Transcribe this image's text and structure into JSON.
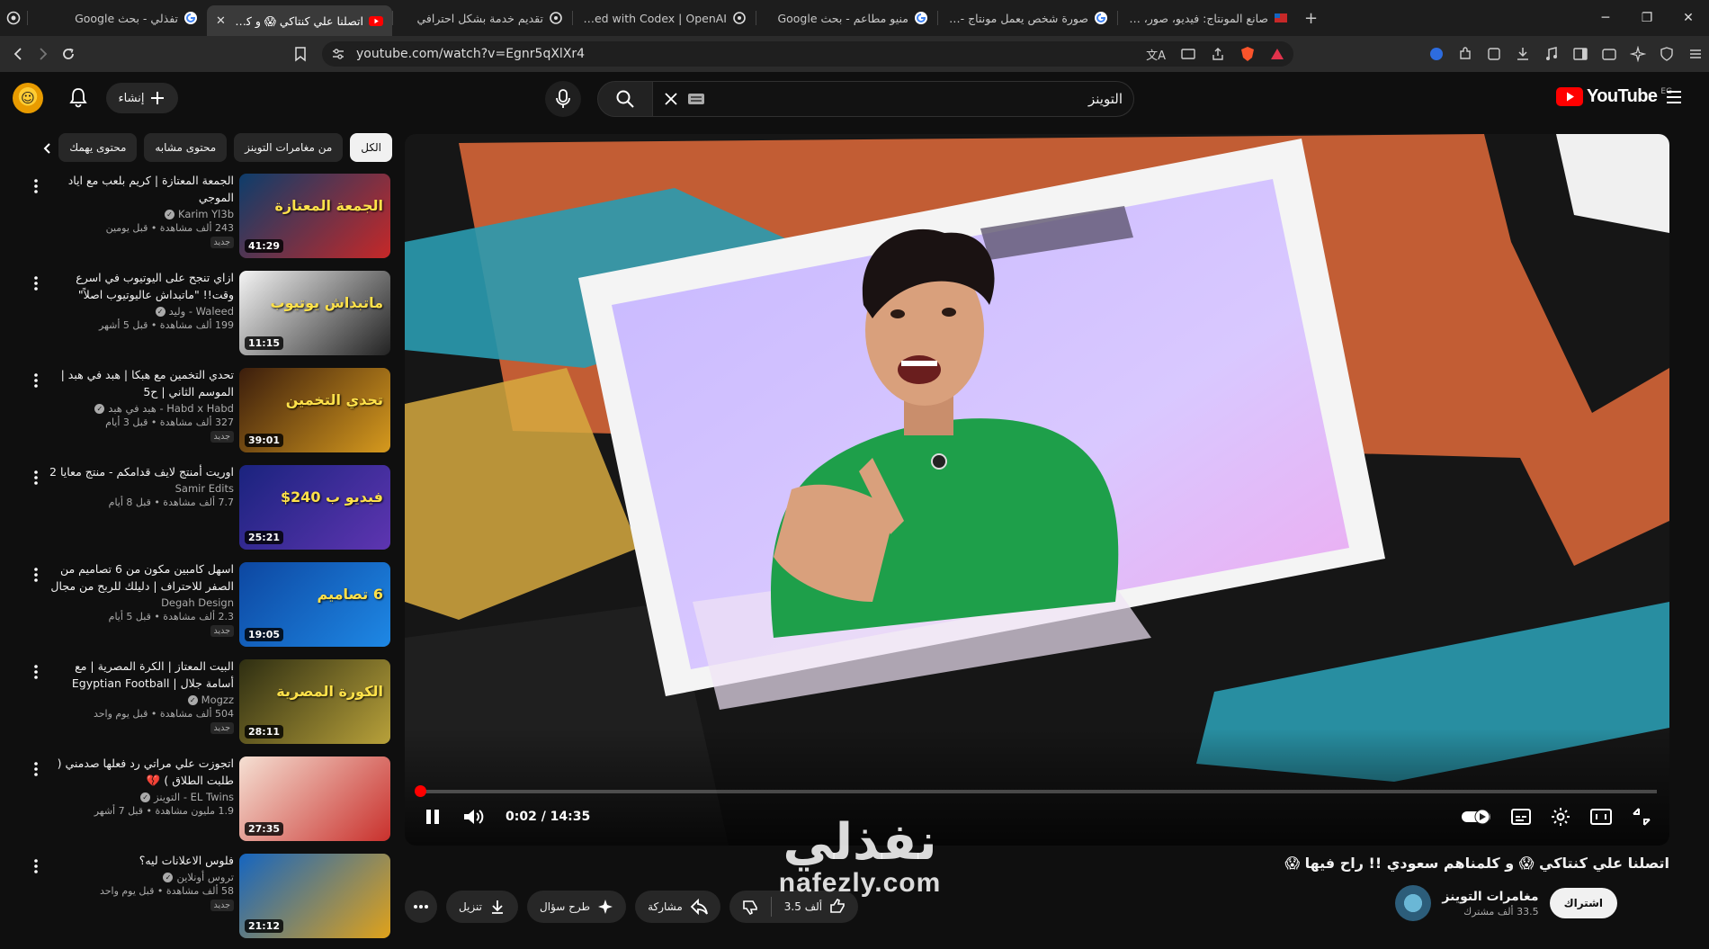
{
  "browser": {
    "tabs": [
      {
        "title": "تفذلي - بحث Google",
        "icon": "google-favicon",
        "active": false
      },
      {
        "title": "اتصلنا علي كنتاكي 😱 و كلمناهم سعودي",
        "icon": "youtube-favicon",
        "active": true
      },
      {
        "title": "تقديم خدمة بشكل احترافي",
        "icon": "openai-favicon",
        "active": false
      },
      {
        "title": "Get started with Codex | OpenAI",
        "icon": "openai-favicon",
        "active": false
      },
      {
        "title": "منيو مطاعم - بحث Google",
        "icon": "google-favicon",
        "active": false
      },
      {
        "title": "صورة شخص يعمل مونتاج - بحث Google",
        "icon": "google-favicon",
        "active": false
      },
      {
        "title": "صانع المونتاج: فيديو، صور، وموسيقى",
        "icon": "app-favicon",
        "active": false
      }
    ],
    "new_tab": "+",
    "url": "youtube.com/watch?v=Egnr5qXlXr4",
    "win_minimize": "─",
    "win_maximize": "❐",
    "win_close": "✕"
  },
  "header": {
    "logo_text": "YouTube",
    "region": "EG",
    "search_value": "التوينز",
    "create_label": "إنشاء"
  },
  "chips": [
    {
      "label": "الكل",
      "active": true
    },
    {
      "label": "من مغامرات التوينز",
      "active": false
    },
    {
      "label": "محتوى مشابه",
      "active": false
    },
    {
      "label": "محتوى يهمك",
      "active": false
    }
  ],
  "related": [
    {
      "title": "الجمعة المعتازة | كريم بلعب مع اياد الموجي",
      "channel": "Karim Yl3b",
      "verified": true,
      "stats": "243 ألف مشاهدة • قبل يومين",
      "badge": "جديد",
      "duration": "41:29",
      "thumb_text": "الجمعة المعتازة",
      "c1": "#0d3d6b",
      "c2": "#c62828"
    },
    {
      "title": "ازاي تنجح على اليوتيوب في اسرع وقت!! \"ماتبداش عاليوتيوب اصلاً\"",
      "channel": "Waleed - وليد",
      "verified": true,
      "stats": "199 ألف مشاهدة • قبل 5 أشهر",
      "badge": "",
      "duration": "11:15",
      "thumb_text": "ماتبداش يوتيوب",
      "c1": "#f4f4f4",
      "c2": "#222222"
    },
    {
      "title": "تحدي التخمين مع هبكا | هبد في هبد | الموسم الثاني | ح5",
      "channel": "Habd x Habd - هبد في هبد",
      "verified": true,
      "stats": "327 ألف مشاهدة • قبل 3 أيام",
      "badge": "جديد",
      "duration": "39:01",
      "thumb_text": "تحدي التخمين",
      "c1": "#3b1d0c",
      "c2": "#d69a1e"
    },
    {
      "title": "اوريت أمنتج لايف قدامكم - منتج معايا 2",
      "channel": "Samir Edits",
      "verified": false,
      "stats": "7.7 ألف مشاهدة • قبل 8 أيام",
      "badge": "",
      "duration": "25:21",
      "thumb_text": "فيديو ب 240$",
      "c1": "#1a237e",
      "c2": "#5e35b1"
    },
    {
      "title": "اسهل كامبين مكون من 6 تصاميم من الصفر للاحتراف | دليلك للربح من مجال الجرافيك ...",
      "channel": "Degah Design",
      "verified": false,
      "stats": "2.3 ألف مشاهدة • قبل 5 أيام",
      "badge": "جديد",
      "duration": "19:05",
      "thumb_text": "6 تصاميم",
      "c1": "#0d47a1",
      "c2": "#1e88e5"
    },
    {
      "title": "البيت المعتاز | الكرة المصرية | مع أسامة جلال | Egyptian Football",
      "channel": "Mogzz",
      "verified": true,
      "stats": "504 ألف مشاهدة • قبل يوم واحد",
      "badge": "جديد",
      "duration": "28:11",
      "thumb_text": "الكورة المصرية",
      "c1": "#2e2e12",
      "c2": "#b8a13a"
    },
    {
      "title": "اتجوزت علي مراتي رد فعلها صدمني ( طلبت الطلاق ) 💔",
      "channel": "EL Twins - التوينز",
      "verified": true,
      "stats": "1.9 مليون مشاهدة • قبل 7 أشهر",
      "badge": "",
      "duration": "27:35",
      "thumb_text": "",
      "c1": "#f5e0d3",
      "c2": "#c9302c"
    },
    {
      "title": "فلوس الاعلانات ليه؟",
      "channel": "تروس أونلاين",
      "verified": true,
      "stats": "58 ألف مشاهدة • قبل يوم واحد",
      "badge": "جديد",
      "duration": "21:12",
      "thumb_text": "",
      "c1": "#1565c0",
      "c2": "#e0a21a"
    }
  ],
  "player": {
    "time": "0:02 / 14:35",
    "progress": 0.0023
  },
  "video": {
    "title": "اتصلنا علي كنتاكي 😱 و كلمناهم سعودي !! راح فيها 😱",
    "channel": "مغامرات التوينز",
    "subs": "33.5 ألف مشترك",
    "subscribe_label": "اشتراك"
  },
  "actions": {
    "download": "تنزيل",
    "ask": "طرح سؤال",
    "share": "مشاركة",
    "like_count": "3.5 ألف"
  },
  "watermark": {
    "ar": "نفذلي",
    "en": "nafezly.com"
  },
  "colors": {
    "accent": "#ff0000",
    "bg": "#0f0f0f",
    "chip": "#272727"
  }
}
